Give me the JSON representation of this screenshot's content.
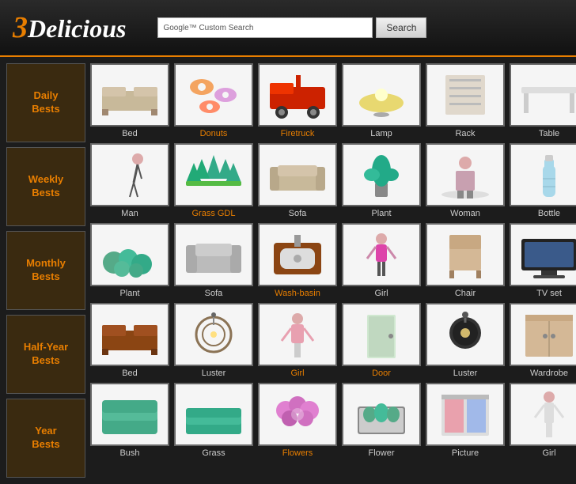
{
  "header": {
    "logo_3": "3",
    "logo_rest": "Delicious",
    "google_label": "Google™ Custom Search",
    "search_placeholder": "",
    "search_button_label": "Search"
  },
  "nav": {
    "items": [
      {
        "id": "daily",
        "label": "Daily\nBests"
      },
      {
        "id": "weekly",
        "label": "Weekly\nBests"
      },
      {
        "id": "monthly",
        "label": "Monthly\nBests"
      },
      {
        "id": "halfyear",
        "label": "Half-Year\nBests"
      },
      {
        "id": "year",
        "label": "Year\nBests"
      }
    ]
  },
  "rows": [
    {
      "nav_label": "Daily Bests",
      "items": [
        {
          "label": "Bed",
          "color": "gray",
          "shape": "bed"
        },
        {
          "label": "Donuts",
          "color": "orange",
          "shape": "donuts"
        },
        {
          "label": "Firetruck",
          "color": "orange",
          "shape": "firetruck"
        },
        {
          "label": "Lamp",
          "color": "gray",
          "shape": "lamp"
        },
        {
          "label": "Rack",
          "color": "gray",
          "shape": "rack"
        },
        {
          "label": "Table",
          "color": "gray",
          "shape": "table"
        }
      ]
    },
    {
      "nav_label": "Weekly Bests",
      "items": [
        {
          "label": "Man",
          "color": "gray",
          "shape": "man"
        },
        {
          "label": "Grass GDL",
          "color": "orange",
          "shape": "grass_gdl"
        },
        {
          "label": "Sofa",
          "color": "gray",
          "shape": "sofa"
        },
        {
          "label": "Plant",
          "color": "gray",
          "shape": "plant"
        },
        {
          "label": "Woman",
          "color": "gray",
          "shape": "woman"
        },
        {
          "label": "Bottle",
          "color": "gray",
          "shape": "bottle"
        }
      ]
    },
    {
      "nav_label": "Monthly Bests",
      "items": [
        {
          "label": "Plant",
          "color": "gray",
          "shape": "plant2"
        },
        {
          "label": "Sofa",
          "color": "gray",
          "shape": "sofa2"
        },
        {
          "label": "Wash-basin",
          "color": "orange",
          "shape": "washbasin"
        },
        {
          "label": "Girl",
          "color": "gray",
          "shape": "girl"
        },
        {
          "label": "Chair",
          "color": "gray",
          "shape": "chair"
        },
        {
          "label": "TV set",
          "color": "gray",
          "shape": "tvset"
        }
      ]
    },
    {
      "nav_label": "Half-Year Bests",
      "items": [
        {
          "label": "Bed",
          "color": "gray",
          "shape": "bed2"
        },
        {
          "label": "Luster",
          "color": "gray",
          "shape": "luster"
        },
        {
          "label": "Girl",
          "color": "orange",
          "shape": "girl2"
        },
        {
          "label": "Door",
          "color": "orange",
          "shape": "door"
        },
        {
          "label": "Luster",
          "color": "gray",
          "shape": "luster2"
        },
        {
          "label": "Wardrobe",
          "color": "gray",
          "shape": "wardrobe"
        }
      ]
    },
    {
      "nav_label": "Year Bests",
      "items": [
        {
          "label": "Bush",
          "color": "gray",
          "shape": "bush"
        },
        {
          "label": "Grass",
          "color": "gray",
          "shape": "grass"
        },
        {
          "label": "Flowers",
          "color": "orange",
          "shape": "flowers"
        },
        {
          "label": "Flower",
          "color": "gray",
          "shape": "flower"
        },
        {
          "label": "Picture",
          "color": "gray",
          "shape": "picture"
        },
        {
          "label": "Girl",
          "color": "gray",
          "shape": "girl3"
        }
      ]
    }
  ]
}
